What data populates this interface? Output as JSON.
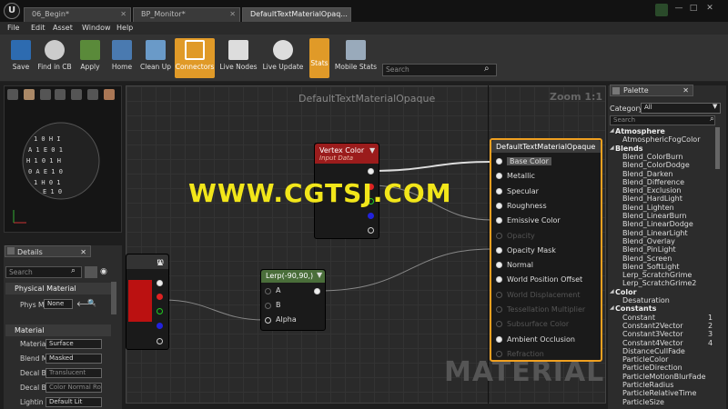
{
  "window": {
    "tabs": [
      "06_Begin*",
      "BP_Monitor*",
      "DefaultTextMaterialOpaq..."
    ],
    "controls": [
      "—",
      "□",
      "✕"
    ]
  },
  "menu": [
    "File",
    "Edit",
    "Asset",
    "Window",
    "Help"
  ],
  "toolbar": {
    "buttons": [
      "Save",
      "Find in CB",
      "Apply",
      "Home",
      "Clean Up",
      "Connectors",
      "Live Nodes",
      "Live Update",
      "Stats",
      "Mobile Stats"
    ],
    "search_placeholder": "Search"
  },
  "graph": {
    "title": "DefaultTextMaterialOpaque",
    "zoom": "Zoom 1:1",
    "watermark": "MATERIAL"
  },
  "overlay": "WWW.CGTSJ.COM",
  "nodes": {
    "vertex": {
      "title": "Vertex Color",
      "subtitle": "Input Data"
    },
    "lerp": {
      "title": "Lerp(-90,90,)",
      "pins": [
        "A",
        "B",
        "Alpha"
      ]
    },
    "left_partial": {
      "title": "m"
    },
    "main": {
      "title": "DefaultTextMaterialOpaque",
      "pins": [
        {
          "label": "Base Color",
          "enabled": true
        },
        {
          "label": "Metallic",
          "enabled": true
        },
        {
          "label": "Specular",
          "enabled": true
        },
        {
          "label": "Roughness",
          "enabled": true
        },
        {
          "label": "Emissive Color",
          "enabled": true
        },
        {
          "label": "Opacity",
          "enabled": false
        },
        {
          "label": "Opacity Mask",
          "enabled": true
        },
        {
          "label": "Normal",
          "enabled": true
        },
        {
          "label": "World Position Offset",
          "enabled": true
        },
        {
          "label": "World Displacement",
          "enabled": false
        },
        {
          "label": "Tessellation Multiplier",
          "enabled": false
        },
        {
          "label": "Subsurface Color",
          "enabled": false
        },
        {
          "label": "Ambient Occlusion",
          "enabled": true
        },
        {
          "label": "Refraction",
          "enabled": false
        }
      ]
    }
  },
  "details": {
    "tab": "Details",
    "search_placeholder": "Search",
    "sections": [
      "Physical Material",
      "Material"
    ],
    "phys_label": "Phys M",
    "phys_value": "None",
    "rows": [
      {
        "label": "Materia",
        "value": "Surface"
      },
      {
        "label": "Blend M",
        "value": "Masked"
      },
      {
        "label": "Decal B",
        "value": "Translucent"
      },
      {
        "label": "Decal B",
        "value": "Color Normal Ro"
      },
      {
        "label": "Lightin",
        "value": "Default Lit"
      }
    ]
  },
  "palette": {
    "tab": "Palette",
    "category_label": "Category:",
    "category_value": "All",
    "search_placeholder": "Search",
    "entries": [
      {
        "t": "cat",
        "text": "Atmosphere"
      },
      {
        "t": "item",
        "text": "AtmosphericFogColor"
      },
      {
        "t": "cat",
        "text": "Blends"
      },
      {
        "t": "item",
        "text": "Blend_ColorBurn"
      },
      {
        "t": "item",
        "text": "Blend_ColorDodge"
      },
      {
        "t": "item",
        "text": "Blend_Darken"
      },
      {
        "t": "item",
        "text": "Blend_Difference"
      },
      {
        "t": "item",
        "text": "Blend_Exclusion"
      },
      {
        "t": "item",
        "text": "Blend_HardLight"
      },
      {
        "t": "item",
        "text": "Blend_Lighten"
      },
      {
        "t": "item",
        "text": "Blend_LinearBurn"
      },
      {
        "t": "item",
        "text": "Blend_LinearDodge"
      },
      {
        "t": "item",
        "text": "Blend_LinearLight"
      },
      {
        "t": "item",
        "text": "Blend_Overlay"
      },
      {
        "t": "item",
        "text": "Blend_PinLight"
      },
      {
        "t": "item",
        "text": "Blend_Screen"
      },
      {
        "t": "item",
        "text": "Blend_SoftLight"
      },
      {
        "t": "item",
        "text": "Lerp_ScratchGrime"
      },
      {
        "t": "item",
        "text": "Lerp_ScratchGrime2"
      },
      {
        "t": "cat",
        "text": "Color"
      },
      {
        "t": "item",
        "text": "Desaturation"
      },
      {
        "t": "cat",
        "text": "Constants"
      },
      {
        "t": "item",
        "text": "Constant",
        "num": "1"
      },
      {
        "t": "item",
        "text": "Constant2Vector",
        "num": "2"
      },
      {
        "t": "item",
        "text": "Constant3Vector",
        "num": "3"
      },
      {
        "t": "item",
        "text": "Constant4Vector",
        "num": "4"
      },
      {
        "t": "item",
        "text": "DistanceCullFade"
      },
      {
        "t": "item",
        "text": "ParticleColor"
      },
      {
        "t": "item",
        "text": "ParticleDirection"
      },
      {
        "t": "item",
        "text": "ParticleMotionBlurFade"
      },
      {
        "t": "item",
        "text": "ParticleRadius"
      },
      {
        "t": "item",
        "text": "ParticleRelativeTime"
      },
      {
        "t": "item",
        "text": "ParticleSize"
      }
    ]
  },
  "colors": {
    "accent": "#e09a28",
    "vertex_header": "#9b1c1c",
    "lerp_header": "#4a6e3a",
    "main_header": "#3c3c3c",
    "selection": "#f0a020"
  }
}
